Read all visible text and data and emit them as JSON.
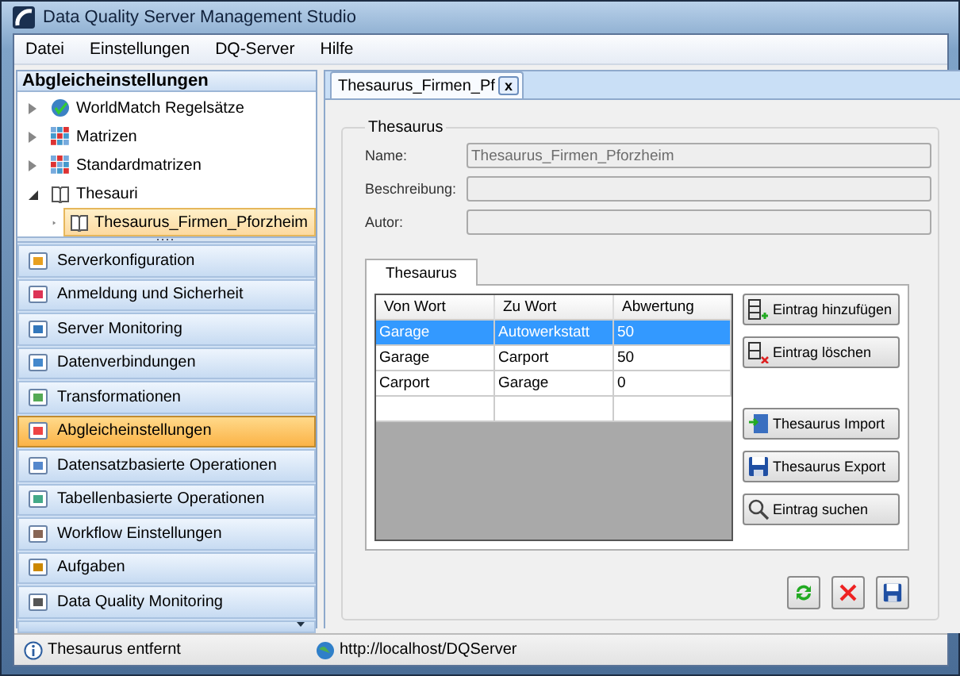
{
  "window": {
    "title": "Data Quality Server Management Studio"
  },
  "menu": [
    {
      "label": "Datei"
    },
    {
      "label": "Einstellungen"
    },
    {
      "label": "DQ-Server"
    },
    {
      "label": "Hilfe"
    }
  ],
  "sidebar": {
    "title": "Abgleicheinstellungen",
    "tree": [
      {
        "label": "WorldMatch Regelsätze",
        "expanded": false,
        "selected": false
      },
      {
        "label": "Matrizen",
        "expanded": false,
        "selected": false
      },
      {
        "label": "Standardmatrizen",
        "expanded": false,
        "selected": false
      },
      {
        "label": "Thesauri",
        "expanded": true,
        "selected": false,
        "children": [
          {
            "label": "Thesaurus_Firmen_Pforzheim",
            "expanded": false,
            "selected": true
          }
        ]
      }
    ],
    "nav": [
      {
        "label": "Serverkonfiguration",
        "selected": false
      },
      {
        "label": "Anmeldung und Sicherheit",
        "selected": false
      },
      {
        "label": "Server Monitoring",
        "selected": false
      },
      {
        "label": "Datenverbindungen",
        "selected": false
      },
      {
        "label": "Transformationen",
        "selected": false
      },
      {
        "label": "Abgleicheinstellungen",
        "selected": true
      },
      {
        "label": "Datensatzbasierte Operationen",
        "selected": false
      },
      {
        "label": "Tabellenbasierte Operationen",
        "selected": false
      },
      {
        "label": "Workflow Einstellungen",
        "selected": false
      },
      {
        "label": "Aufgaben",
        "selected": false
      },
      {
        "label": "Data Quality Monitoring",
        "selected": false
      }
    ]
  },
  "document_tabs": [
    {
      "label": "Thesaurus_Firmen_Pf",
      "close": "x",
      "selected": true
    }
  ],
  "group": {
    "title": "Thesaurus",
    "fields": [
      {
        "label": "Name:",
        "value": "Thesaurus_Firmen_Pforzheim"
      },
      {
        "label": "Beschreibung:"
      },
      {
        "label": "Autor:"
      }
    ],
    "inner_tabs": [
      {
        "label": "Thesaurus",
        "selected": true
      }
    ],
    "table": {
      "columns": [
        "Von Wort",
        "Zu Wort",
        "Abwertung"
      ],
      "rows": [
        {
          "cells": [
            "Garage",
            "Autowerkstatt",
            "50"
          ],
          "selected": true
        },
        {
          "cells": [
            "Garage",
            "Carport",
            "50"
          ],
          "selected": false
        },
        {
          "cells": [
            "Carport",
            "Garage",
            "0"
          ],
          "selected": false
        }
      ]
    },
    "buttons": [
      {
        "label": "Eintrag hinzufügen",
        "kind": "add"
      },
      {
        "label": "Eintrag löschen",
        "kind": "delete"
      },
      {
        "label": "Thesaurus Import",
        "kind": "import"
      },
      {
        "label": "Thesaurus Export",
        "kind": "export"
      },
      {
        "label": "Eintrag suchen",
        "kind": "search"
      }
    ]
  },
  "status_bar": {
    "message": "Thesaurus entfernt",
    "server": "http://localhost/DQServer"
  }
}
